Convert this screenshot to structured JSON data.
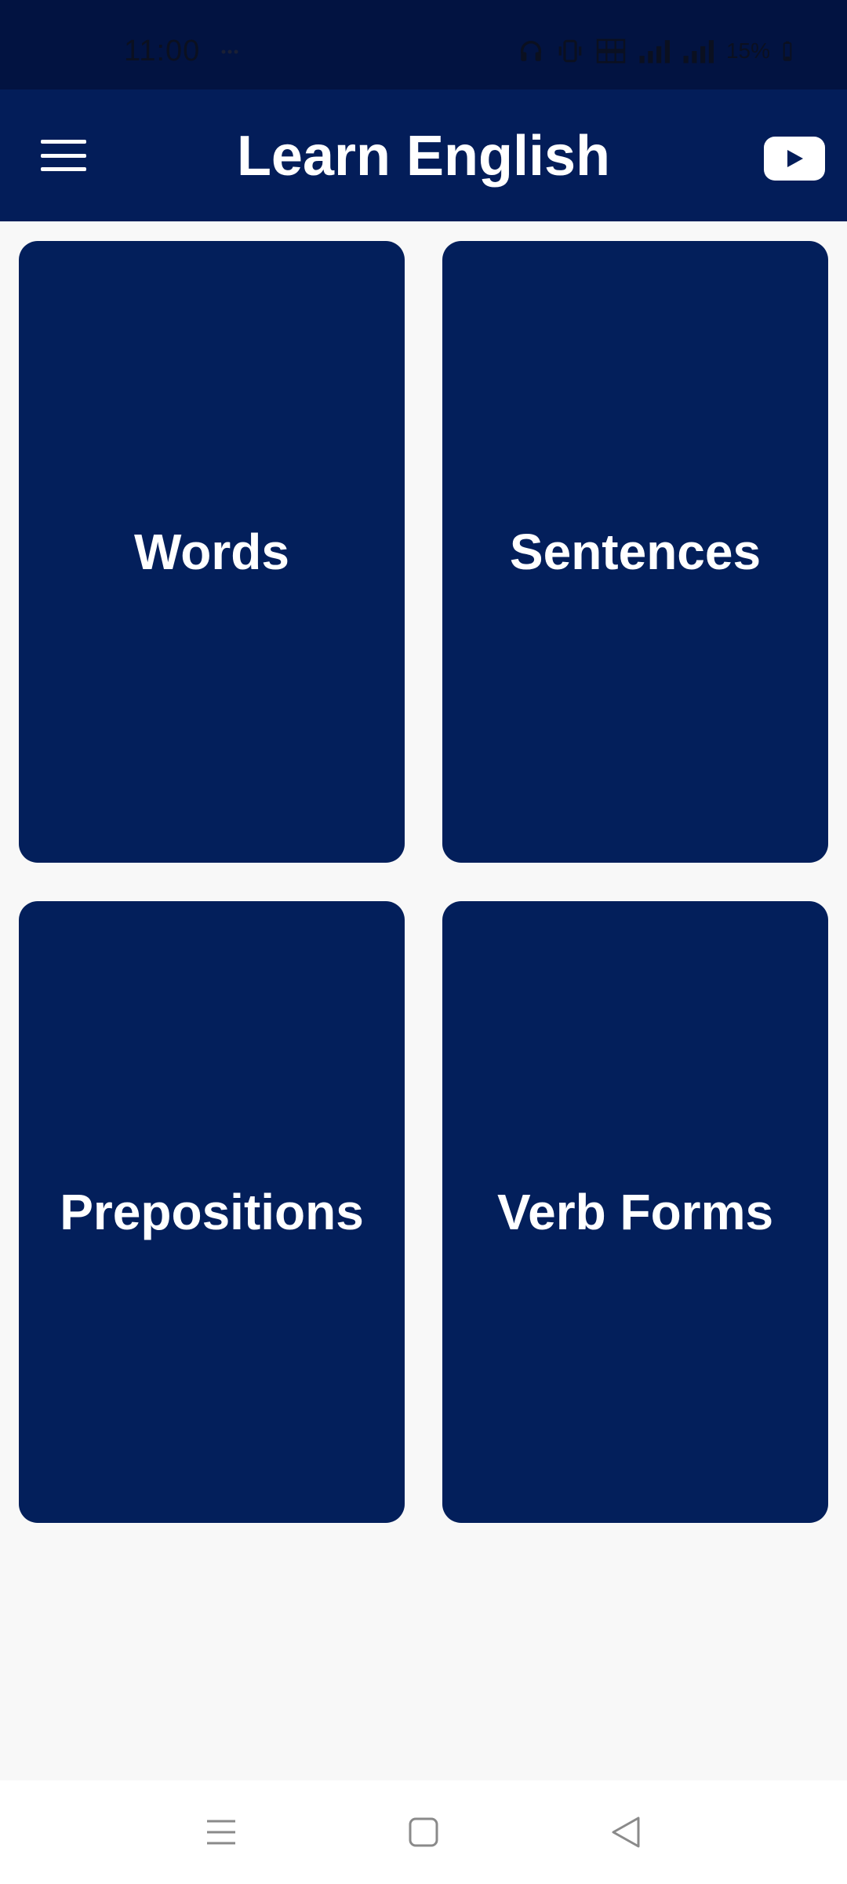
{
  "status_bar": {
    "time": "11:00",
    "battery": "15%",
    "icons": [
      "headphones-icon",
      "vibrate-icon",
      "volte-icon",
      "signal-icon",
      "signal-icon",
      "battery-icon"
    ]
  },
  "app_bar": {
    "title": "Learn English",
    "menu_icon": "hamburger-menu-icon",
    "action_icon": "youtube-icon"
  },
  "cards": [
    {
      "label": "Words"
    },
    {
      "label": "Sentences"
    },
    {
      "label": "Prepositions"
    },
    {
      "label": "Verb Forms"
    }
  ],
  "nav_bar": {
    "items": [
      "recents-icon",
      "home-icon",
      "back-icon"
    ]
  },
  "colors": {
    "status_bar": "#021341",
    "app_bar": "#031d59",
    "card": "#031f5b",
    "background": "#f8f8f8",
    "text_on_dark": "#ffffff"
  }
}
